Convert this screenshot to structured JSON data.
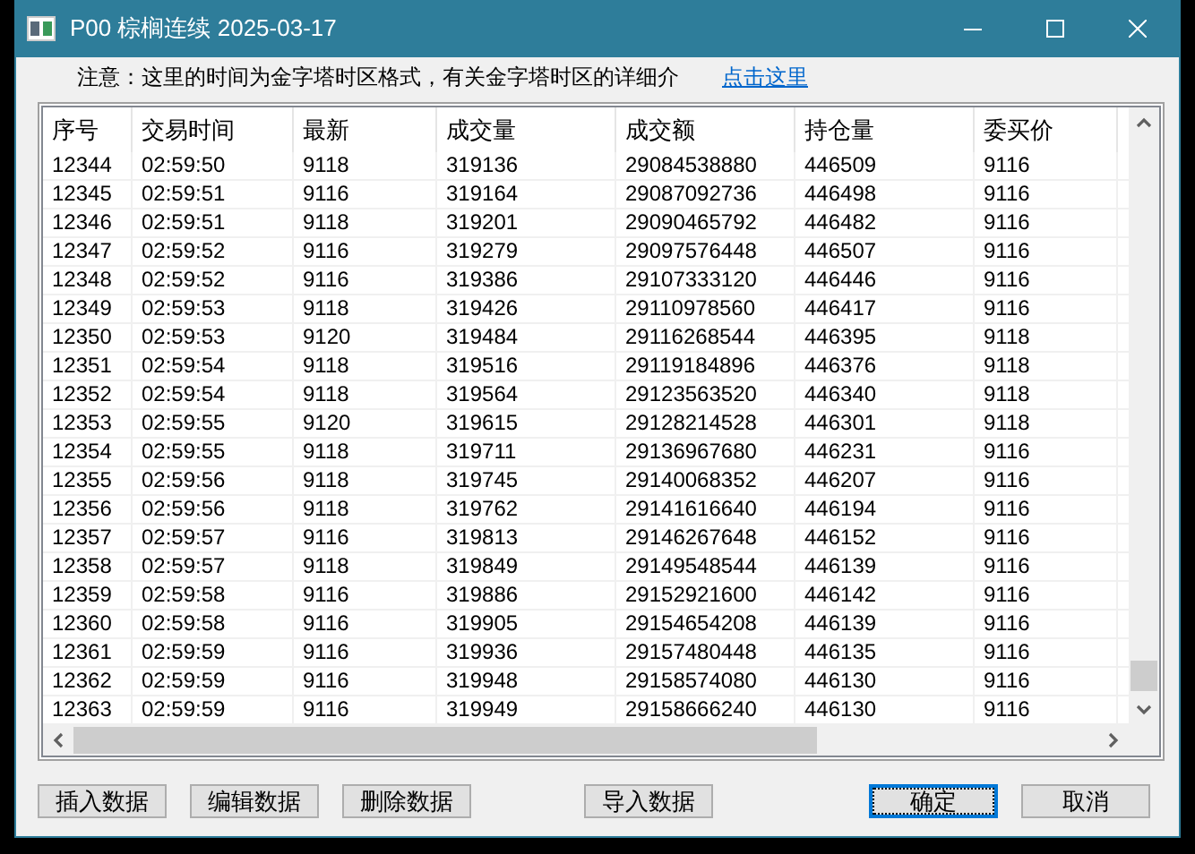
{
  "window": {
    "title": "P00 棕榈连续 2025-03-17"
  },
  "notice": {
    "text": "注意：这里的时间为金字塔时区格式，有关金字塔时区的详细介",
    "link": "点击这里"
  },
  "table": {
    "columns": [
      "序号",
      "交易时间",
      "最新",
      "成交量",
      "成交额",
      "持仓量",
      "委买价"
    ],
    "rows": [
      [
        "12344",
        "02:59:50",
        "9118",
        "319136",
        "29084538880",
        "446509",
        "9116"
      ],
      [
        "12345",
        "02:59:51",
        "9116",
        "319164",
        "29087092736",
        "446498",
        "9116"
      ],
      [
        "12346",
        "02:59:51",
        "9118",
        "319201",
        "29090465792",
        "446482",
        "9116"
      ],
      [
        "12347",
        "02:59:52",
        "9116",
        "319279",
        "29097576448",
        "446507",
        "9116"
      ],
      [
        "12348",
        "02:59:52",
        "9116",
        "319386",
        "29107333120",
        "446446",
        "9116"
      ],
      [
        "12349",
        "02:59:53",
        "9118",
        "319426",
        "29110978560",
        "446417",
        "9116"
      ],
      [
        "12350",
        "02:59:53",
        "9120",
        "319484",
        "29116268544",
        "446395",
        "9118"
      ],
      [
        "12351",
        "02:59:54",
        "9118",
        "319516",
        "29119184896",
        "446376",
        "9118"
      ],
      [
        "12352",
        "02:59:54",
        "9118",
        "319564",
        "29123563520",
        "446340",
        "9118"
      ],
      [
        "12353",
        "02:59:55",
        "9120",
        "319615",
        "29128214528",
        "446301",
        "9118"
      ],
      [
        "12354",
        "02:59:55",
        "9118",
        "319711",
        "29136967680",
        "446231",
        "9116"
      ],
      [
        "12355",
        "02:59:56",
        "9118",
        "319745",
        "29140068352",
        "446207",
        "9116"
      ],
      [
        "12356",
        "02:59:56",
        "9118",
        "319762",
        "29141616640",
        "446194",
        "9116"
      ],
      [
        "12357",
        "02:59:57",
        "9116",
        "319813",
        "29146267648",
        "446152",
        "9116"
      ],
      [
        "12358",
        "02:59:57",
        "9118",
        "319849",
        "29149548544",
        "446139",
        "9116"
      ],
      [
        "12359",
        "02:59:58",
        "9116",
        "319886",
        "29152921600",
        "446142",
        "9116"
      ],
      [
        "12360",
        "02:59:58",
        "9116",
        "319905",
        "29154654208",
        "446139",
        "9116"
      ],
      [
        "12361",
        "02:59:59",
        "9116",
        "319936",
        "29157480448",
        "446135",
        "9116"
      ],
      [
        "12362",
        "02:59:59",
        "9116",
        "319948",
        "29158574080",
        "446130",
        "9116"
      ],
      [
        "12363",
        "02:59:59",
        "9116",
        "319949",
        "29158666240",
        "446130",
        "9116"
      ]
    ]
  },
  "button_groups": [
    [
      {
        "label": "插入数据",
        "focused": false
      },
      {
        "label": "编辑数据",
        "focused": false
      },
      {
        "label": "删除数据",
        "focused": false
      }
    ],
    [
      {
        "label": "导入数据",
        "focused": false
      }
    ],
    [
      {
        "label": "确定",
        "focused": true
      },
      {
        "label": "取消",
        "focused": false
      }
    ]
  ]
}
